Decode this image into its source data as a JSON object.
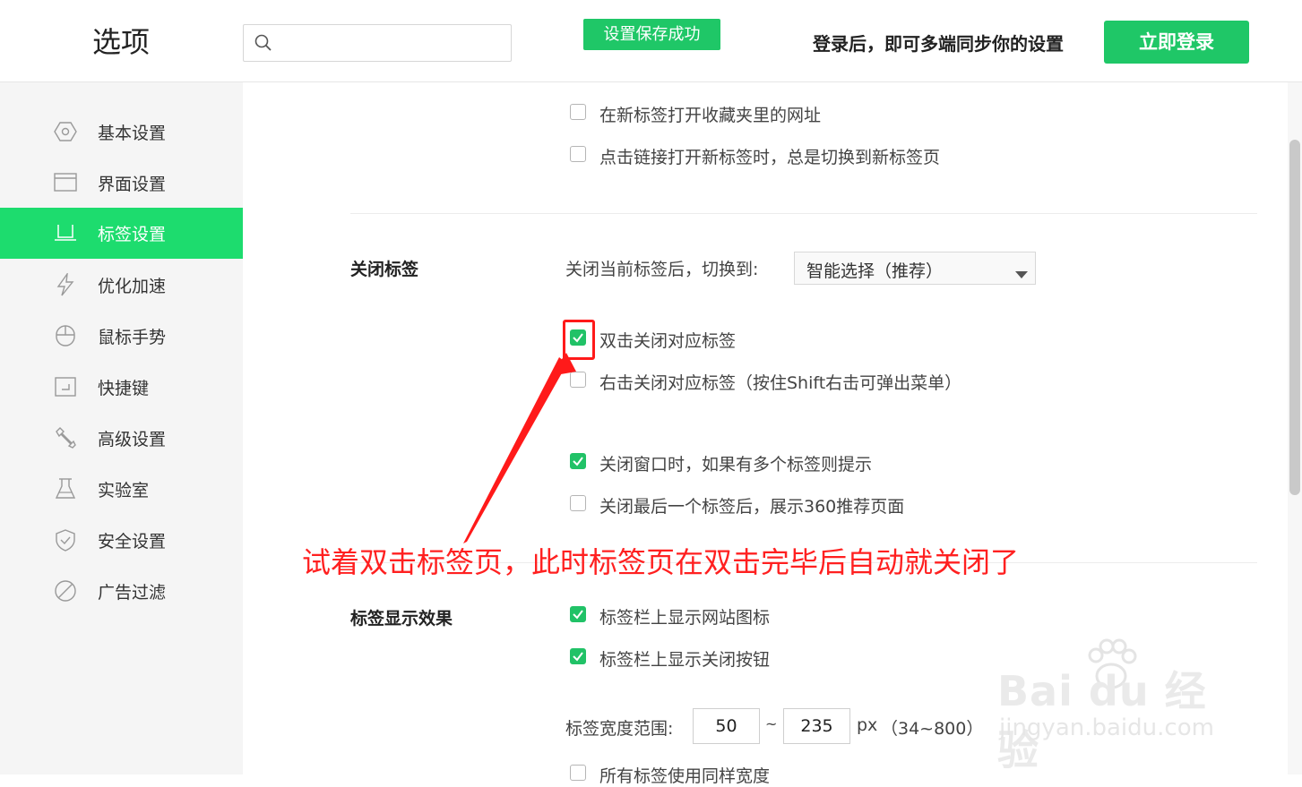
{
  "header": {
    "app_title": "选项",
    "search_placeholder": "",
    "toast": "设置保存成功",
    "sync_text": "登录后，即可多端同步你的设置",
    "login_button": "立即登录"
  },
  "sidebar": {
    "items": [
      {
        "label": "基本设置",
        "icon": "hexagon-settings-icon",
        "active": false
      },
      {
        "label": "界面设置",
        "icon": "window-icon",
        "active": false
      },
      {
        "label": "标签设置",
        "icon": "tab-icon",
        "active": true
      },
      {
        "label": "优化加速",
        "icon": "lightning-icon",
        "active": false
      },
      {
        "label": "鼠标手势",
        "icon": "mouse-icon",
        "active": false
      },
      {
        "label": "快捷键",
        "icon": "keyboard-shortcut-icon",
        "active": false
      },
      {
        "label": "高级设置",
        "icon": "wrench-icon",
        "active": false
      },
      {
        "label": "实验室",
        "icon": "flask-icon",
        "active": false
      },
      {
        "label": "安全设置",
        "icon": "shield-icon",
        "active": false
      },
      {
        "label": "广告过滤",
        "icon": "block-icon",
        "active": false
      }
    ]
  },
  "content": {
    "top_options": [
      {
        "label": "在新标签打开收藏夹里的网址",
        "checked": false
      },
      {
        "label": "点击链接打开新标签时，总是切换到新标签页",
        "checked": false
      }
    ],
    "close_tab": {
      "section_label": "关闭标签",
      "switch_label": "关闭当前标签后，切换到:",
      "switch_value": "智能选择（推荐）",
      "options": [
        {
          "label": "双击关闭对应标签",
          "checked": true
        },
        {
          "label": "右击关闭对应标签（按住Shift右击可弹出菜单）",
          "checked": false
        },
        {
          "label": "关闭窗口时，如果有多个标签则提示",
          "checked": true
        },
        {
          "label": "关闭最后一个标签后，展示360推荐页面",
          "checked": false
        }
      ]
    },
    "display": {
      "section_label": "标签显示效果",
      "options": [
        {
          "label": "标签栏上显示网站图标",
          "checked": true
        },
        {
          "label": "标签栏上显示关闭按钮",
          "checked": true
        }
      ],
      "width_label": "标签宽度范围:",
      "min_width": "50",
      "tilde": "~",
      "max_width": "235",
      "unit": "px",
      "range_hint": "（34~800）",
      "partial_option": "所有标签使用同样宽度"
    }
  },
  "annotation": {
    "text": "试着双击标签页，此时标签页在双击完毕后自动就关闭了",
    "color": "#ff2020"
  },
  "watermark": {
    "brand": "Bai du 经验",
    "url": "jingyan.baidu.com"
  },
  "colors": {
    "accent": "#1fc767",
    "active_nav": "#1ddc6e",
    "annotation": "#ff1a1a"
  }
}
